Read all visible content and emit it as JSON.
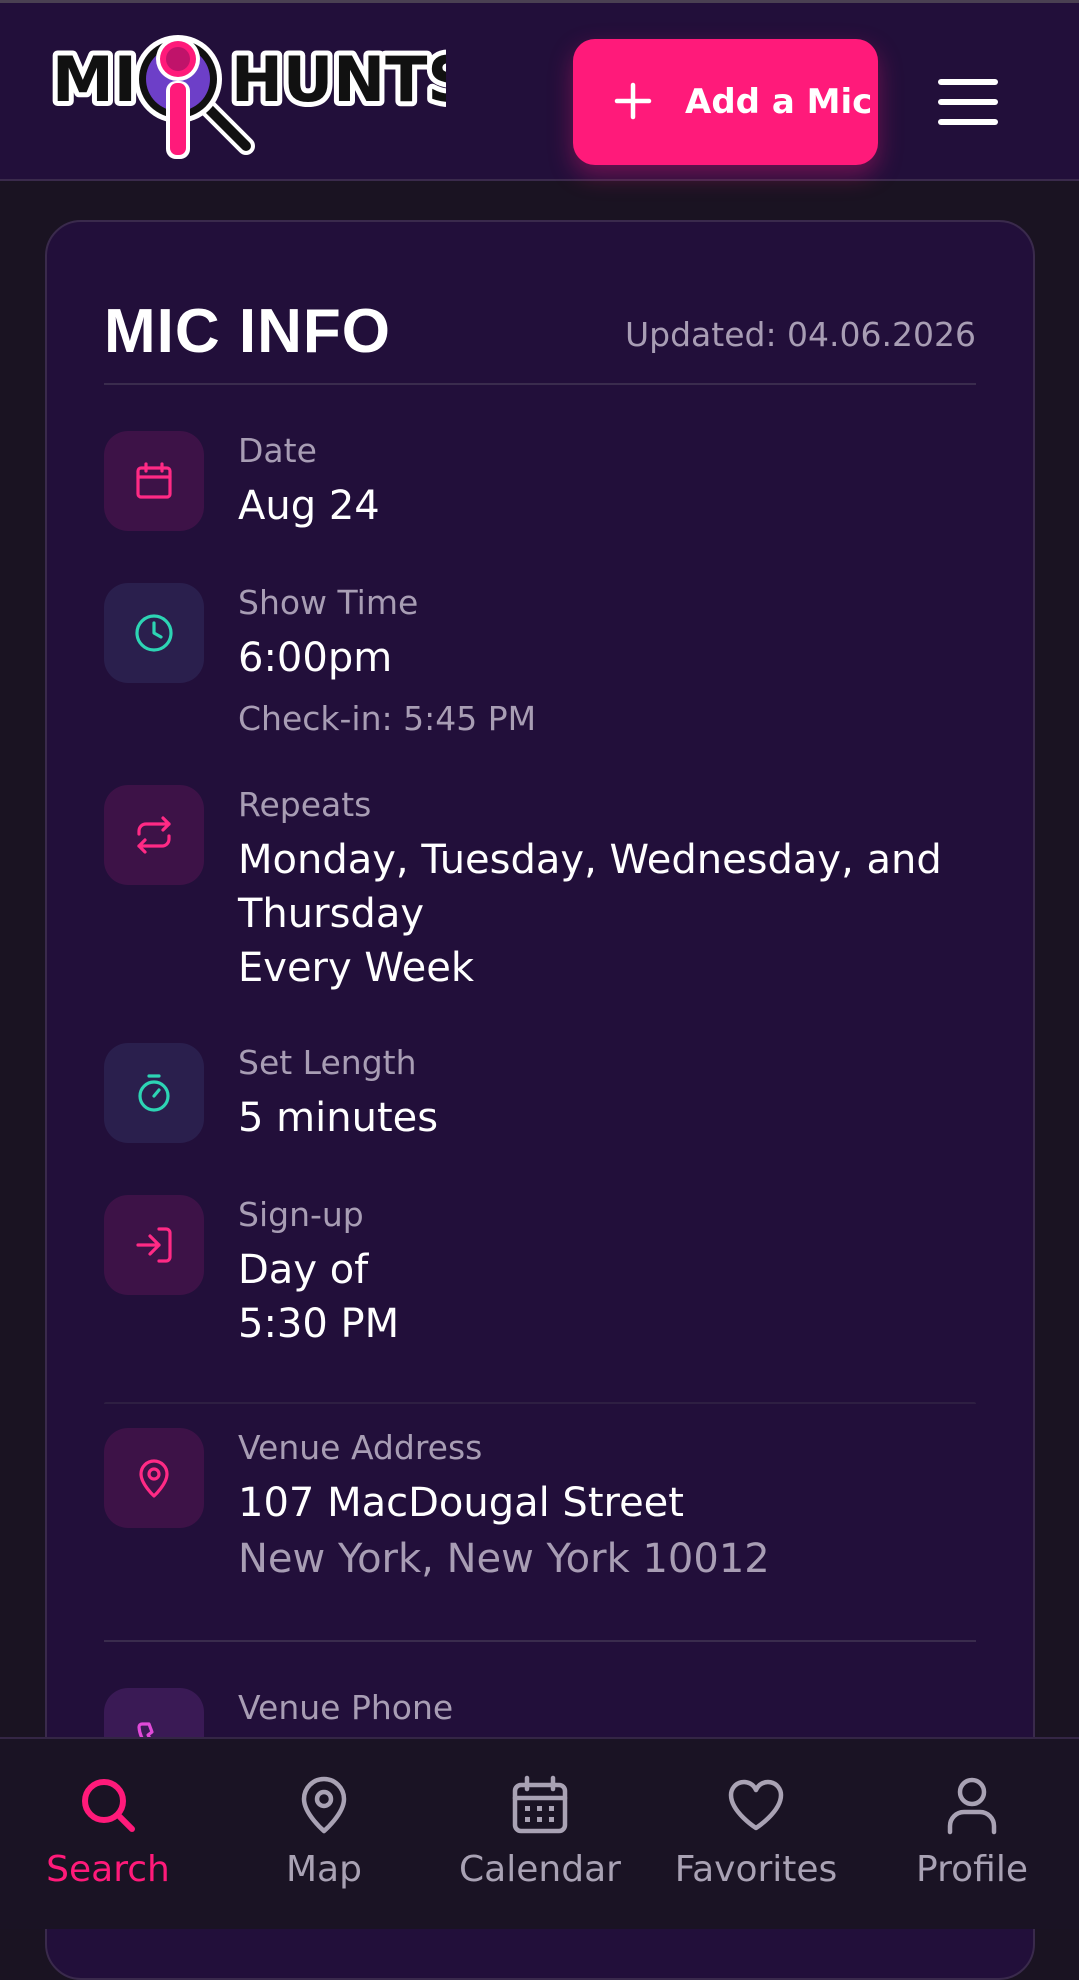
{
  "header": {
    "logo_text": "MIC HUNTS",
    "add_button_label": "Add a Mic"
  },
  "card": {
    "title": "MIC INFO",
    "updated": "Updated: 04.06.2026",
    "rows": [
      {
        "label": "Date",
        "value": "Aug 24",
        "icon": "calendar-icon"
      },
      {
        "label": "Show Time",
        "value": "6:00pm",
        "sub": "Check-in: 5:45 PM",
        "icon": "clock-icon"
      },
      {
        "label": "Repeats",
        "value": "Monday, Tuesday, Wednesday, and Thursday",
        "value2": "Every Week",
        "icon": "repeat-icon"
      },
      {
        "label": "Set Length",
        "value": "5 minutes",
        "icon": "stopwatch-icon"
      },
      {
        "label": "Sign-up",
        "value": "Day of",
        "value2": "5:30 PM",
        "icon": "sign-in-icon"
      },
      {
        "label": "Venue Address",
        "value": "107 MacDougal Street",
        "sub": "New York, New York 10012",
        "icon": "map-pin-icon"
      },
      {
        "label": "Venue Phone",
        "icon": "phone-icon"
      }
    ]
  },
  "nav": {
    "items": [
      {
        "label": "Search",
        "active": true
      },
      {
        "label": "Map"
      },
      {
        "label": "Calendar"
      },
      {
        "label": "Favorites"
      },
      {
        "label": "Profile"
      }
    ]
  },
  "colors": {
    "accent": "#ff1a7a",
    "teal": "#2dd4b4",
    "background": "#220f3a"
  }
}
